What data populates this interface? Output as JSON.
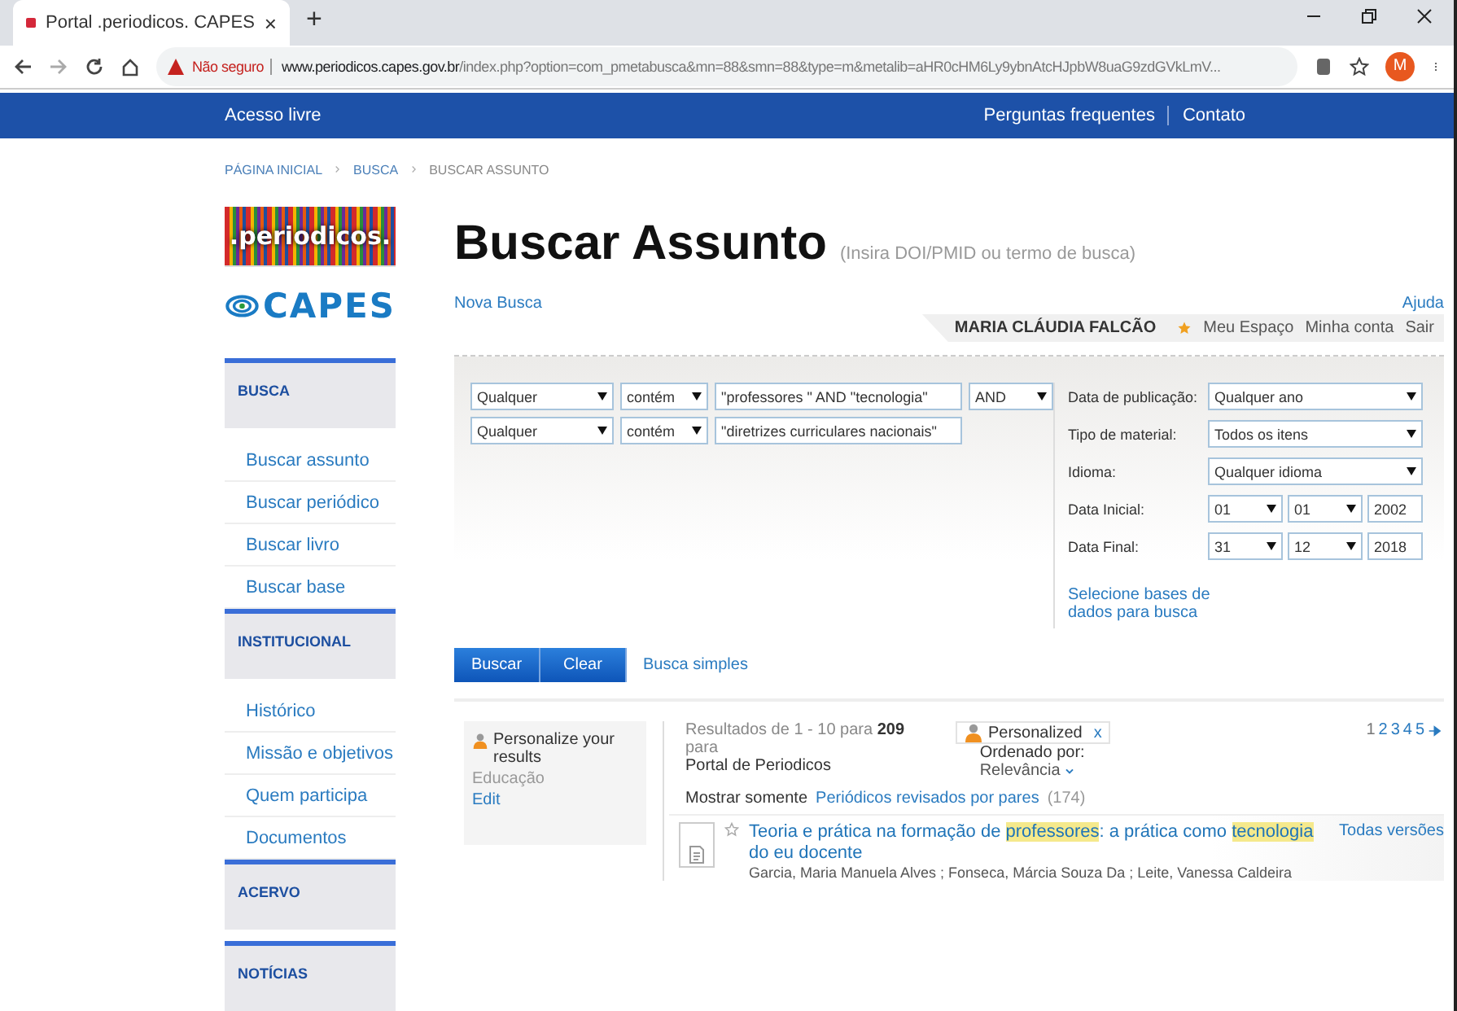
{
  "browser": {
    "tab_title": "Portal .periodicos. CAPES",
    "tab_close": "×",
    "new_tab": "+",
    "warning": "Não seguro",
    "domain": "www.periodicos.capes.gov.br",
    "path": "/index.php?option=com_pmetabusca&mn=88&smn=88&type=m&metalib=aHR0cHM6Ly9ybnAtcHJpbW8uaG9zdGVkLmV...",
    "profile": "M"
  },
  "topnav": {
    "left": "Acesso livre",
    "right": [
      "Perguntas frequentes",
      "Contato"
    ]
  },
  "breadcrumb": [
    "PÁGINA INICIAL",
    "BUSCA",
    "BUSCAR ASSUNTO"
  ],
  "logo": {
    "periodicos": ".periodicos.",
    "capes": "CAPES"
  },
  "sidebar": [
    {
      "title": "BUSCA",
      "items": [
        "Buscar assunto",
        "Buscar periódico",
        "Buscar livro",
        "Buscar base"
      ]
    },
    {
      "title": "INSTITUCIONAL",
      "items": [
        "Histórico",
        "Missão e objetivos",
        "Quem participa",
        "Documentos"
      ]
    },
    {
      "title": "ACERVO"
    },
    {
      "title": "NOTÍCIAS"
    }
  ],
  "header": {
    "title": "Buscar Assunto",
    "hint": "(Insira DOI/PMID ou termo de busca)",
    "new_search": "Nova Busca",
    "help": "Ajuda"
  },
  "user": {
    "name": "MARIA CLÁUDIA FALCÃO",
    "links": [
      "Meu Espaço",
      "Minha conta",
      "Sair"
    ]
  },
  "query_rows": [
    {
      "field": "Qualquer",
      "operator": "contém",
      "term": "\"professores \" AND \"tecnologia\"",
      "boolean": "AND"
    },
    {
      "field": "Qualquer",
      "operator": "contém",
      "term": "\"diretrizes curriculares nacionais\""
    }
  ],
  "filters": [
    {
      "kind": "select",
      "label": "Data de publicação:",
      "value": "Qualquer ano"
    },
    {
      "kind": "select",
      "label": "Tipo de material:",
      "value": "Todos os itens"
    },
    {
      "kind": "select",
      "label": "Idioma:",
      "value": "Qualquer idioma"
    },
    {
      "kind": "date",
      "label": "Data Inicial:",
      "day": "01",
      "month": "01",
      "year": "2002"
    },
    {
      "kind": "date",
      "label": "Data Final:",
      "day": "31",
      "month": "12",
      "year": "2018"
    }
  ],
  "select_bases": "Selecione bases de dados para busca",
  "buttons": [
    "Buscar",
    "Clear"
  ],
  "simple_search": "Busca simples",
  "personalize": {
    "title": "Personalize your results",
    "subject": "Educação",
    "edit": "Edit"
  },
  "results": {
    "summary": "Resultados de 1 - 10 para **209** para",
    "source": "Portal de Periodicos",
    "chip": "Personalized",
    "chip_close": "x",
    "sort_label": "Ordenado por:",
    "sort_value": "Relevância",
    "pages": [
      {
        "label": "1",
        "selected": true
      },
      {
        "label": "2",
        "selected": false
      },
      {
        "label": "3",
        "selected": false
      },
      {
        "label": "4",
        "selected": false
      },
      {
        "label": "5",
        "selected": false
      }
    ],
    "show_only": "Mostrar somente",
    "peer_reviewed": "Periódicos revisados por pares",
    "peer_count": "(174)",
    "items": [
      {
        "title_parts": [
          {
            "text": "Teoria e prática na formação de ",
            "highlighted": false
          },
          {
            "text": "professores",
            "highlighted": true
          },
          {
            "text": ": a prática como ",
            "highlighted": false
          },
          {
            "text": "tecnologia",
            "highlighted": true
          },
          {
            "text": " do eu docente",
            "highlighted": false
          }
        ],
        "versions": "Todas versões",
        "authors": "Garcia, Maria Manuela Alves ; Fonseca, Márcia Souza Da ; Leite, Vanessa Caldeira"
      }
    ]
  }
}
